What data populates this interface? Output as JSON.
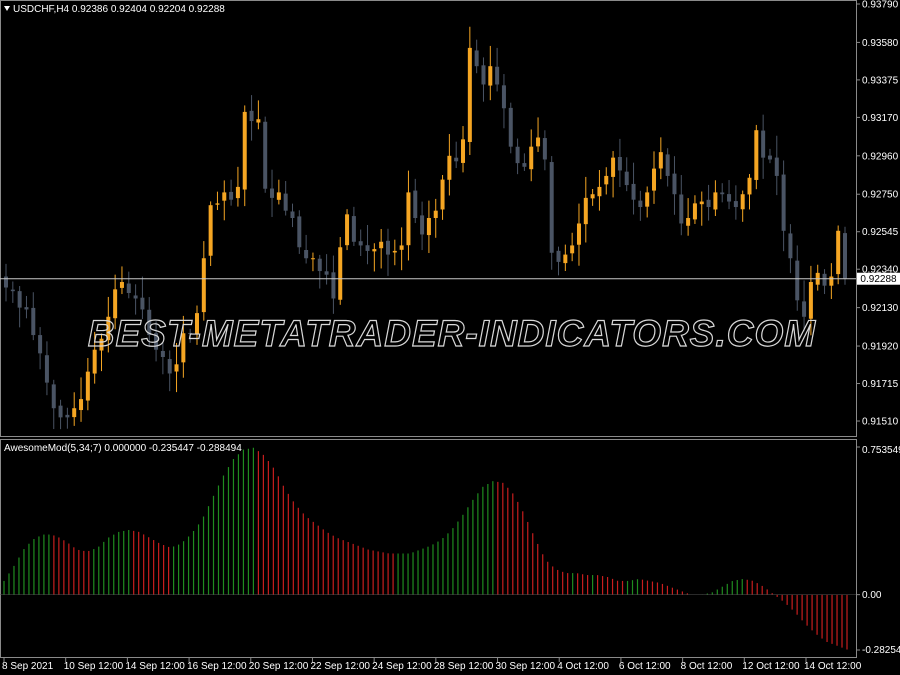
{
  "price_panel": {
    "title": "USDCHF,H4  0.92386 0.92404 0.92204 0.92288",
    "price_ticks": [
      "0.93790",
      "0.93580",
      "0.93375",
      "0.93170",
      "0.92960",
      "0.92750",
      "0.92545",
      "0.92340",
      "0.92130",
      "0.91920",
      "0.91715",
      "0.91510"
    ],
    "current_price_label": "0.92288"
  },
  "indicator_panel": {
    "title": "AwesomeMod(5,34;7) 0.000000 -0.235447 -0.288494",
    "scale_ticks": [
      "0.753549",
      "0.00",
      "-0.282542"
    ]
  },
  "time_axis": {
    "labels": [
      "8 Sep 2021",
      "10 Sep 12:00",
      "14 Sep 12:00",
      "16 Sep 12:00",
      "20 Sep 12:00",
      "22 Sep 12:00",
      "24 Sep 12:00",
      "28 Sep 12:00",
      "30 Sep 12:00",
      "4 Oct 12:00",
      "6 Oct 12:00",
      "8 Oct 12:00",
      "12 Oct 12:00",
      "14 Oct 12:00"
    ]
  },
  "watermark": "BEST-METATRADER-INDICATORS.COM",
  "colors": {
    "background": "#000000",
    "bull_candle": "#f5a623",
    "bear_candle": "#4a5464",
    "ao_up": "#1f8c1f",
    "ao_down": "#c81e1e",
    "grid_line": "#c8c8c8"
  },
  "chart_data": [
    {
      "type": "candlestick",
      "symbol": "USDCHF",
      "timeframe": "H4",
      "ylim": [
        0.9145,
        0.9379
      ],
      "current_price": 0.92288,
      "close_path": [
        0.9224,
        0.9222,
        0.9213,
        0.9212,
        0.9198,
        0.9188,
        0.9172,
        0.9158,
        0.9153,
        0.9153,
        0.9158,
        0.9163,
        0.9178,
        0.919,
        0.9196,
        0.9208,
        0.9223,
        0.9227,
        0.9221,
        0.9218,
        0.9212,
        0.9198,
        0.919,
        0.9186,
        0.9177,
        0.9182,
        0.9199,
        0.9199,
        0.921,
        0.924,
        0.9269,
        0.927,
        0.9276,
        0.9272,
        0.9279,
        0.932,
        0.9315,
        0.9316,
        0.9278,
        0.9273,
        0.9276,
        0.9266,
        0.9262,
        0.9246,
        0.924,
        0.924,
        0.9233,
        0.9231,
        0.9218,
        0.9246,
        0.9264,
        0.9249,
        0.9247,
        0.9244,
        0.9245,
        0.9249,
        0.9242,
        0.9244,
        0.9247,
        0.9276,
        0.9262,
        0.9253,
        0.9262,
        0.9266,
        0.9283,
        0.9296,
        0.9293,
        0.9305,
        0.9355,
        0.9345,
        0.9335,
        0.9345,
        0.9335,
        0.9322,
        0.9301,
        0.9292,
        0.929,
        0.9301,
        0.9306,
        0.9294,
        0.9243,
        0.9238,
        0.9242,
        0.9247,
        0.9259,
        0.9273,
        0.9275,
        0.9279,
        0.9285,
        0.9295,
        0.9288,
        0.928,
        0.9272,
        0.9268,
        0.9276,
        0.9289,
        0.9298,
        0.9285,
        0.9275,
        0.9259,
        0.9262,
        0.927,
        0.9271,
        0.9268,
        0.9276,
        0.9275,
        0.9271,
        0.9268,
        0.9275,
        0.9284,
        0.931,
        0.9295,
        0.9294,
        0.9285,
        0.9255,
        0.924,
        0.9217,
        0.9208,
        0.9227,
        0.9232,
        0.9225,
        0.923,
        0.9255,
        0.9229
      ]
    },
    {
      "type": "bar",
      "name": "AwesomeMod(5,34;7)",
      "ylim": [
        -0.282542,
        0.753549
      ],
      "values_path": [
        0.07,
        0.15,
        0.24,
        0.29,
        0.31,
        0.3,
        0.27,
        0.23,
        0.22,
        0.24,
        0.29,
        0.32,
        0.33,
        0.32,
        0.29,
        0.26,
        0.24,
        0.26,
        0.31,
        0.38,
        0.49,
        0.6,
        0.69,
        0.74,
        0.75,
        0.71,
        0.64,
        0.54,
        0.46,
        0.4,
        0.36,
        0.32,
        0.29,
        0.27,
        0.25,
        0.23,
        0.22,
        0.21,
        0.21,
        0.21,
        0.23,
        0.25,
        0.28,
        0.33,
        0.4,
        0.48,
        0.55,
        0.58,
        0.57,
        0.51,
        0.41,
        0.29,
        0.18,
        0.13,
        0.11,
        0.11,
        0.1,
        0.1,
        0.09,
        0.07,
        0.07,
        0.08,
        0.07,
        0.06,
        0.04,
        0.02,
        0.0,
        0.0,
        0.01,
        0.04,
        0.07,
        0.08,
        0.07,
        0.04,
        0.0,
        -0.04,
        -0.09,
        -0.15,
        -0.2,
        -0.24,
        -0.26,
        -0.28
      ]
    }
  ]
}
